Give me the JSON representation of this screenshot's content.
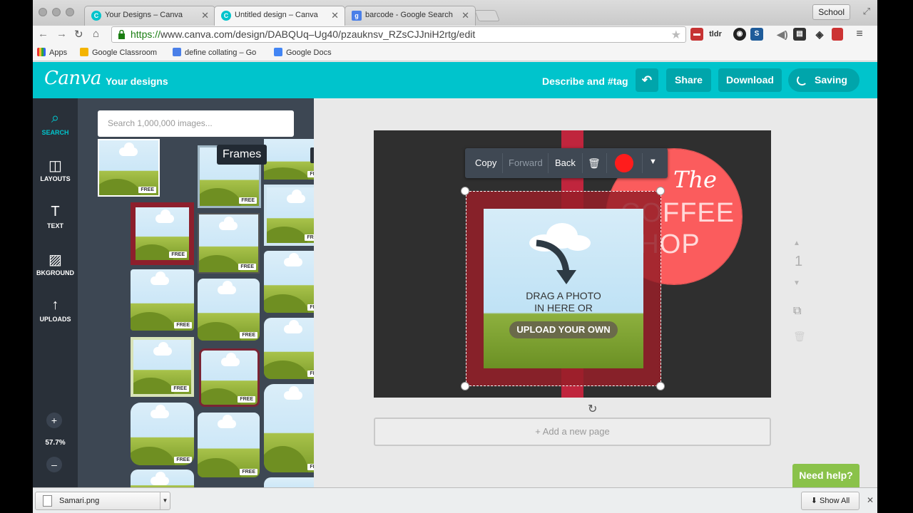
{
  "browser": {
    "tabs": [
      {
        "title": "Your Designs – Canva",
        "favicon": "canva-icon"
      },
      {
        "title": "Untitled design – Canva",
        "favicon": "canva-icon"
      },
      {
        "title": "barcode - Google Search",
        "favicon": "google-icon"
      }
    ],
    "profile": "School",
    "url_scheme": "https://",
    "url_host": "www.canva.com",
    "url_path": "/design/DABQUq–Ug40/pzauknsv_RZsCJJniH2rtg/edit",
    "bookmarks": [
      {
        "label": "Apps",
        "icon": "apps-grid-icon"
      },
      {
        "label": "Google Classroom",
        "icon": "classroom-icon"
      },
      {
        "label": "define collating – Go",
        "icon": "google-icon"
      },
      {
        "label": "Google Docs",
        "icon": "docs-icon"
      }
    ],
    "extensions": [
      "tldr",
      "S"
    ]
  },
  "header": {
    "logo": "Canva",
    "your_designs": "Your designs",
    "describe": "Describe and #tag",
    "share": "Share",
    "download": "Download",
    "saving": "Saving"
  },
  "leftnav": {
    "items": [
      {
        "label": "SEARCH",
        "icon": "search-icon"
      },
      {
        "label": "LAYOUTS",
        "icon": "layouts-icon"
      },
      {
        "label": "TEXT",
        "icon": "text-icon"
      },
      {
        "label": "BKGROUND",
        "icon": "background-icon"
      },
      {
        "label": "UPLOADS",
        "icon": "upload-icon"
      }
    ],
    "zoom_plus": "+",
    "zoom": "57.7%",
    "zoom_minus": "–"
  },
  "panel": {
    "search_placeholder": "Search 1,000,000 images...",
    "tooltip": "Frames",
    "close": "✕",
    "badge": "FREE"
  },
  "canvas": {
    "coffee_the": "The",
    "coffee_line1": "COFFEE",
    "coffee_line2": "SHOP",
    "drag_line1": "DRAG A PHOTO",
    "drag_line2": "IN HERE OR",
    "upload": "UPLOAD YOUR OWN",
    "colors": {
      "stripe": "#c0253d",
      "circle": "#fb5c5d",
      "frame": "#961e28",
      "selected_color": "#ff1c1c"
    }
  },
  "context_toolbar": {
    "copy": "Copy",
    "forward": "Forward",
    "back": "Back"
  },
  "workspace": {
    "add_page": "+ Add a new page",
    "page_number": "1",
    "need_help": "Need help?"
  },
  "download_shelf": {
    "file": "Samari.png",
    "show_all": "Show All"
  }
}
